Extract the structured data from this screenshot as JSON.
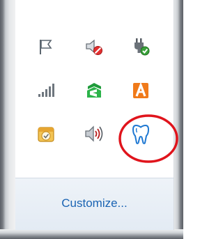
{
  "tray": {
    "icons": [
      {
        "id": "flag-icon"
      },
      {
        "id": "volume-muted-icon"
      },
      {
        "id": "power-plug-icon"
      },
      {
        "id": "network-signal-icon"
      },
      {
        "id": "green-app-icon"
      },
      {
        "id": "orange-a-app-icon"
      },
      {
        "id": "calendar-clock-icon"
      },
      {
        "id": "speaker-icon"
      },
      {
        "id": "tooth-icon"
      }
    ]
  },
  "footer": {
    "customize_label": "Customize..."
  },
  "colors": {
    "highlight_ring": "#e0141c",
    "link": "#1a63b3",
    "tooth_blue": "#1e78d2"
  }
}
